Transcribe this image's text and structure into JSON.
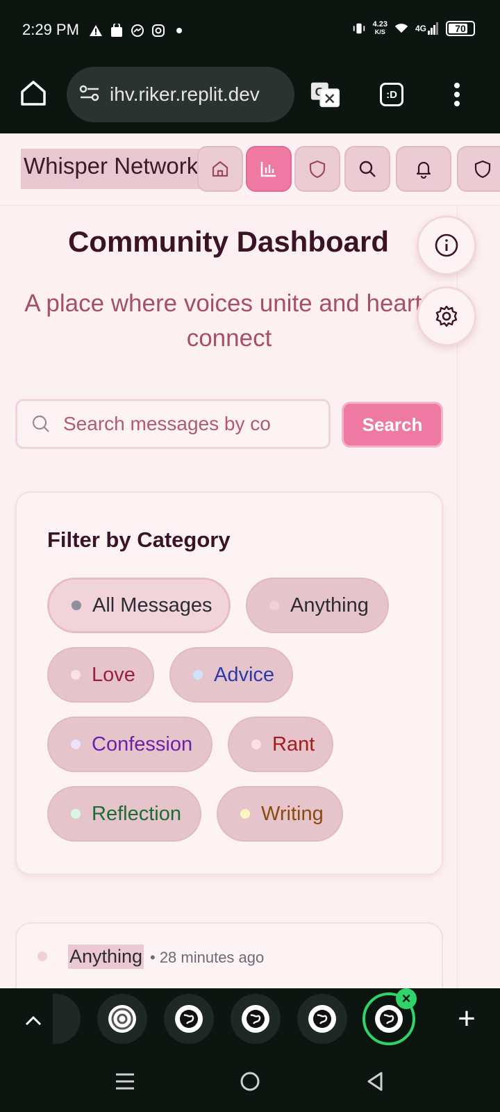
{
  "status_bar": {
    "time": "2:29 PM",
    "net_speed_value": "4.23",
    "net_speed_unit": "K/S",
    "network": "4G",
    "battery": "70"
  },
  "browser": {
    "url": "ihv.riker.replit.dev",
    "translate_icon": "translate-icon",
    "tab_switch_label": ":D"
  },
  "site": {
    "brand": "Whisper Network",
    "nav": [
      {
        "icon": "home-icon"
      },
      {
        "icon": "chart-icon",
        "active": true
      },
      {
        "icon": "shield-icon"
      },
      {
        "icon": "search-icon"
      },
      {
        "icon": "bell-icon"
      },
      {
        "icon": "shield-icon"
      }
    ]
  },
  "page": {
    "title": "Community Dashboard",
    "subtitle": "A place where voices unite and hearts connect",
    "search": {
      "placeholder": "Search messages by co",
      "button": "Search"
    },
    "filter": {
      "title": "Filter by Category",
      "chips": [
        {
          "label": "All Messages",
          "dot": "#8f8f9e",
          "color": "#2b2b36",
          "selected": true
        },
        {
          "label": "Anything",
          "dot": "#f2d0da",
          "color": "#2b2b36"
        },
        {
          "label": "Love",
          "dot": "#fbe1ea",
          "color": "#9b1d4a"
        },
        {
          "label": "Advice",
          "dot": "#cfe3fb",
          "color": "#2b3aa8"
        },
        {
          "label": "Confession",
          "dot": "#ece2fb",
          "color": "#6b22a8"
        },
        {
          "label": "Rant",
          "dot": "#fde1e4",
          "color": "#a31c1c"
        },
        {
          "label": "Reflection",
          "dot": "#d8f7e1",
          "color": "#1d6b36"
        },
        {
          "label": "Writing",
          "dot": "#fdf6bf",
          "color": "#8a4b12"
        }
      ]
    },
    "message": {
      "category": "Anything",
      "time": "• 28 minutes ago"
    }
  },
  "fabs": {
    "info_icon": "info-icon",
    "settings_icon": "gear-icon"
  },
  "tabs": {
    "add_label": "+"
  }
}
